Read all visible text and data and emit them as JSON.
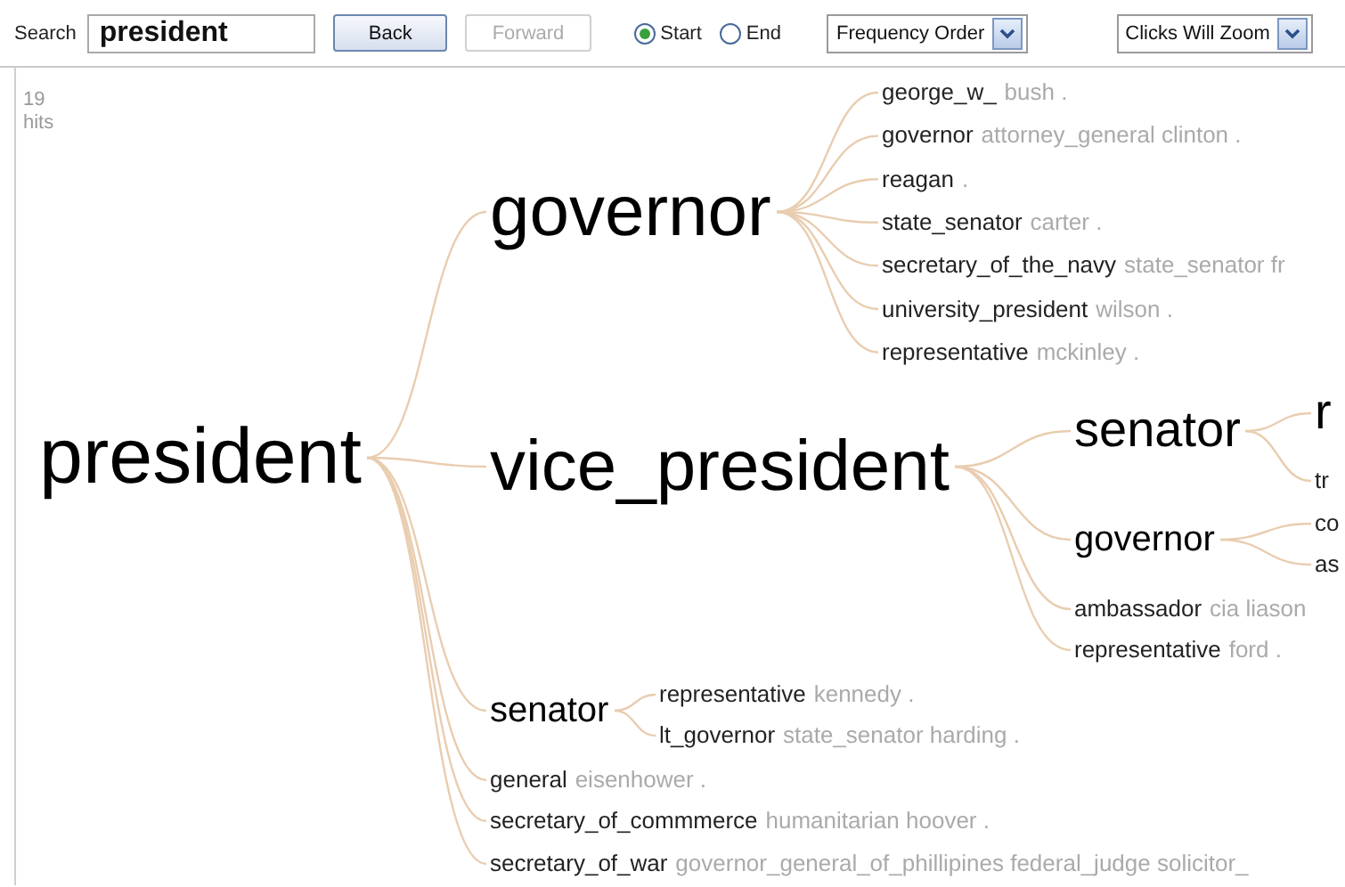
{
  "search": {
    "label": "Search",
    "value": "president"
  },
  "buttons": [
    {
      "label": "Back",
      "disabled": false
    },
    {
      "label": "Forward",
      "disabled": true
    }
  ],
  "anchor": [
    {
      "label": "Start",
      "selected": true
    },
    {
      "label": "End",
      "selected": false
    }
  ],
  "dropdowns": [
    {
      "value": "Frequency Order"
    },
    {
      "value": "Clicks Will Zoom"
    }
  ],
  "hits": {
    "count": "19",
    "label": "hits"
  },
  "tree": {
    "word": "president",
    "kind": "huge",
    "children": [
      {
        "word": "governor",
        "kind": "large",
        "children": [
          {
            "word": "george_w_",
            "tail": "bush .",
            "kind": "leaf"
          },
          {
            "word": "governor",
            "tail": "attorney_general clinton .",
            "kind": "leaf"
          },
          {
            "word": "reagan",
            "tail": ".",
            "kind": "leaf"
          },
          {
            "word": "state_senator",
            "tail": "carter .",
            "kind": "leaf"
          },
          {
            "word": "secretary_of_the_navy",
            "tail": "state_senator fr",
            "kind": "leaf"
          },
          {
            "word": "university_president",
            "tail": "wilson .",
            "kind": "leaf"
          },
          {
            "word": "representative",
            "tail": "mckinley .",
            "kind": "leaf"
          }
        ]
      },
      {
        "word": "vice_president",
        "kind": "large",
        "children": [
          {
            "word": "senator",
            "kind": "medium",
            "children": [
              {
                "word": "r",
                "kind": "medium"
              },
              {
                "word": "tr",
                "kind": "leaf"
              }
            ]
          },
          {
            "word": "governor",
            "kind": "small",
            "children": [
              {
                "word": "co",
                "kind": "leaf"
              },
              {
                "word": "as",
                "kind": "leaf"
              }
            ]
          },
          {
            "word": "ambassador",
            "tail": "cia liason",
            "kind": "leaf"
          },
          {
            "word": "representative",
            "tail": "ford .",
            "kind": "leaf"
          }
        ]
      },
      {
        "word": "senator",
        "kind": "small",
        "children": [
          {
            "word": "representative",
            "tail": "kennedy .",
            "kind": "leaf"
          },
          {
            "word": "lt_governor",
            "tail": "state_senator harding .",
            "kind": "leaf"
          }
        ]
      },
      {
        "word": "general",
        "tail": "eisenhower .",
        "kind": "leaf"
      },
      {
        "word": "secretary_of_commmerce",
        "tail": "humanitarian hoover .",
        "kind": "leaf"
      },
      {
        "word": "secretary_of_war",
        "tail": "governor_general_of_phillipines federal_judge solicitor_",
        "kind": "leaf"
      }
    ]
  }
}
